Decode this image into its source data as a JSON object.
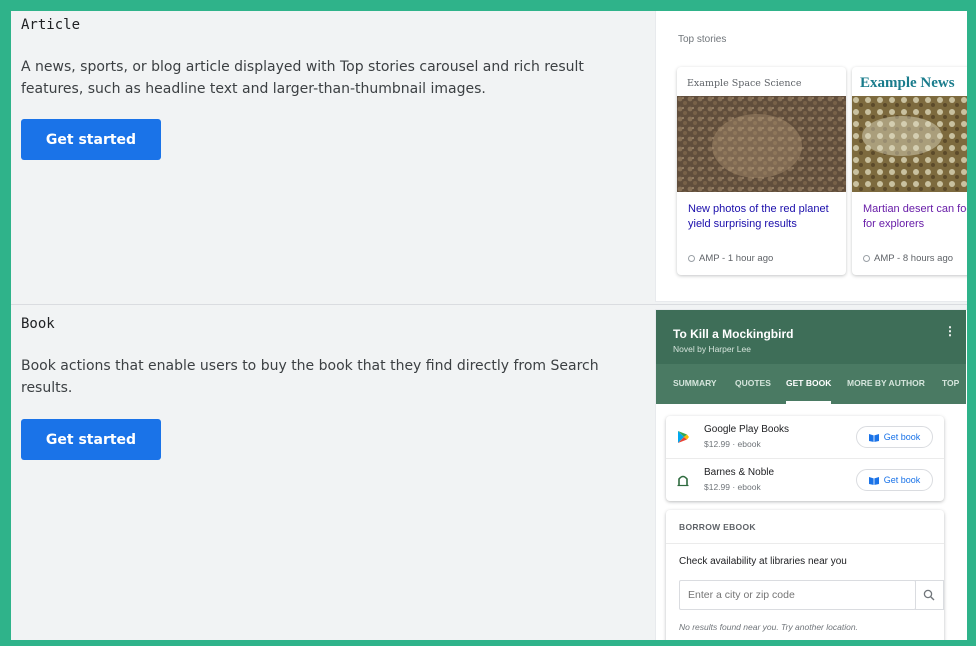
{
  "colors": {
    "border": "#2fb38a",
    "background": "#f1f3f4",
    "button": "#1a73e8",
    "book_header": "#3e6e58"
  },
  "sections": {
    "article": {
      "title": "Article",
      "description": "A news, sports, or blog article displayed with Top stories carousel and rich result features, such as headline text and larger-than-thumbnail images.",
      "button_label": "Get started",
      "preview": {
        "label": "Top stories",
        "cards": [
          {
            "publisher": "Example Space Science",
            "headline": "New photos of the red planet yield surprising results",
            "meta": "AMP - 1 hour ago"
          },
          {
            "publisher": "Example News",
            "headline": "Martian desert can food for explorers",
            "meta": "AMP - 8 hours ago"
          }
        ]
      }
    },
    "book": {
      "title": "Book",
      "description": "Book actions that enable users to buy the book that they find directly from Search results.",
      "button_label": "Get started",
      "preview": {
        "title": "To Kill a Mockingbird",
        "subtitle": "Novel by Harper Lee",
        "more": "⋮",
        "tabs": [
          "SUMMARY",
          "QUOTES",
          "GET BOOK",
          "MORE BY AUTHOR",
          "TOP"
        ],
        "active_tab": "GET BOOK",
        "retailers": [
          {
            "name": "Google Play Books",
            "price": "$12.99 · ebook",
            "action": "Get book",
            "icon": "google-play-icon"
          },
          {
            "name": "Barnes & Noble",
            "price": "$12.99 · ebook",
            "action": "Get book",
            "icon": "barnes-noble-icon"
          }
        ],
        "borrow": {
          "title": "BORROW EBOOK",
          "check": "Check availability at libraries near you",
          "placeholder": "Enter a city or zip code",
          "note": "No results found near you. Try another location."
        }
      }
    }
  }
}
